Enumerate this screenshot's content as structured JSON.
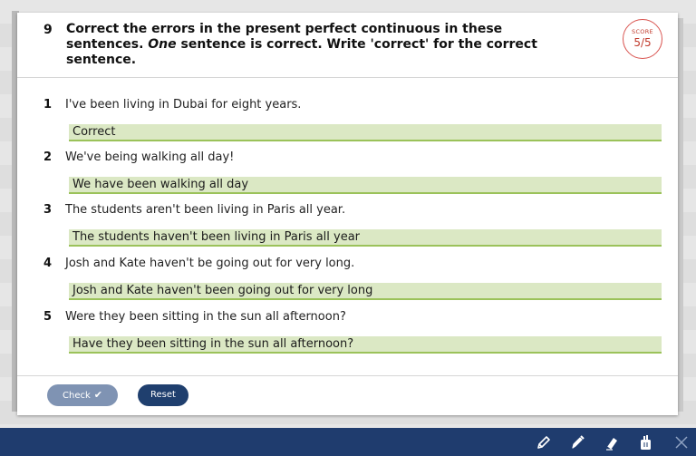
{
  "question": {
    "number": "9",
    "instruction_part1": "Correct the errors in the present perfect continuous in these sentences.",
    "instruction_emphasis": "One",
    "instruction_part2": "sentence is correct. Write 'correct' for the correct sentence.",
    "score_label": "SCORE",
    "score_value": "5/5"
  },
  "items": [
    {
      "number": "1",
      "sentence": "I've been living in Dubai for eight years.",
      "answer": "Correct"
    },
    {
      "number": "2",
      "sentence": "We've being walking all day!",
      "answer": "We have been walking all day"
    },
    {
      "number": "3",
      "sentence": "The students aren't been living in Paris all year.",
      "answer": "The students haven't been living in Paris all year"
    },
    {
      "number": "4",
      "sentence": "Josh and Kate haven't be going out for very long.",
      "answer": "Josh and Kate haven't been going out for very long"
    },
    {
      "number": "5",
      "sentence": "Were they been sitting in the sun all afternoon?",
      "answer": "Have they been sitting in the sun all afternoon?"
    }
  ],
  "footer": {
    "check_label": "Check",
    "reset_label": "Reset"
  },
  "toolbar": {
    "icons": [
      "pencil-icon",
      "marker-icon",
      "eraser-icon",
      "clear-icon",
      "close-icon"
    ]
  },
  "colors": {
    "answer_bg": "#dbe8c4",
    "answer_border": "#9bc25a",
    "toolbar_bg": "#1f3c6e",
    "score_red": "#d9534f",
    "check_btn": "#7f93b3",
    "reset_btn": "#1f3f6e"
  }
}
